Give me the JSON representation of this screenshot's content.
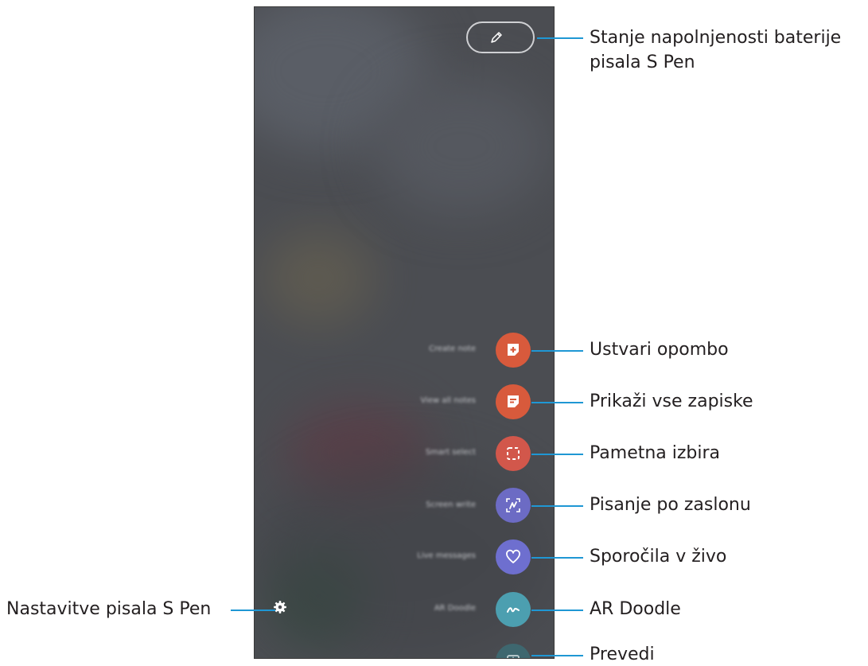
{
  "battery_pill": {
    "level_text": "",
    "icon": "pen-icon"
  },
  "commands": [
    {
      "id": "create-note",
      "label": "Ustvari opombo",
      "icon": "note-plus-icon",
      "color": "#d85a3c"
    },
    {
      "id": "view-all-notes",
      "label": "Prikaži vse zapiske",
      "icon": "notes-list-icon",
      "color": "#d85a3c"
    },
    {
      "id": "smart-select",
      "label": "Pametna izbira",
      "icon": "dashed-select-icon",
      "color": "#d2574b"
    },
    {
      "id": "screen-write",
      "label": "Pisanje po zaslonu",
      "icon": "screen-write-icon",
      "color": "#6c6bc4"
    },
    {
      "id": "live-messages",
      "label": "Sporočila v živo",
      "icon": "heart-icon",
      "color": "#6e6fcf"
    },
    {
      "id": "ar-doodle",
      "label": "AR Doodle",
      "icon": "doodle-icon",
      "color": "#4c9fb0"
    },
    {
      "id": "translate",
      "label": "Prevedi",
      "icon": "translate-icon",
      "color": "#3d6b73"
    }
  ],
  "settings": {
    "icon": "gear-icon"
  },
  "callouts": {
    "battery_line1": "Stanje napolnjenosti baterije",
    "battery_line2": "pisala S Pen",
    "create_note": "Ustvari opombo",
    "view_all": "Prikaži vse zapiske",
    "smart_select": "Pametna izbira",
    "screen_write": "Pisanje po zaslonu",
    "live_messages": "Sporočila v živo",
    "ar_doodle": "AR Doodle",
    "translate": "Prevedi",
    "settings": "Nastavitve pisala S Pen"
  },
  "colors": {
    "callout_line": "#1f97d4",
    "background": "#4b4d52"
  }
}
